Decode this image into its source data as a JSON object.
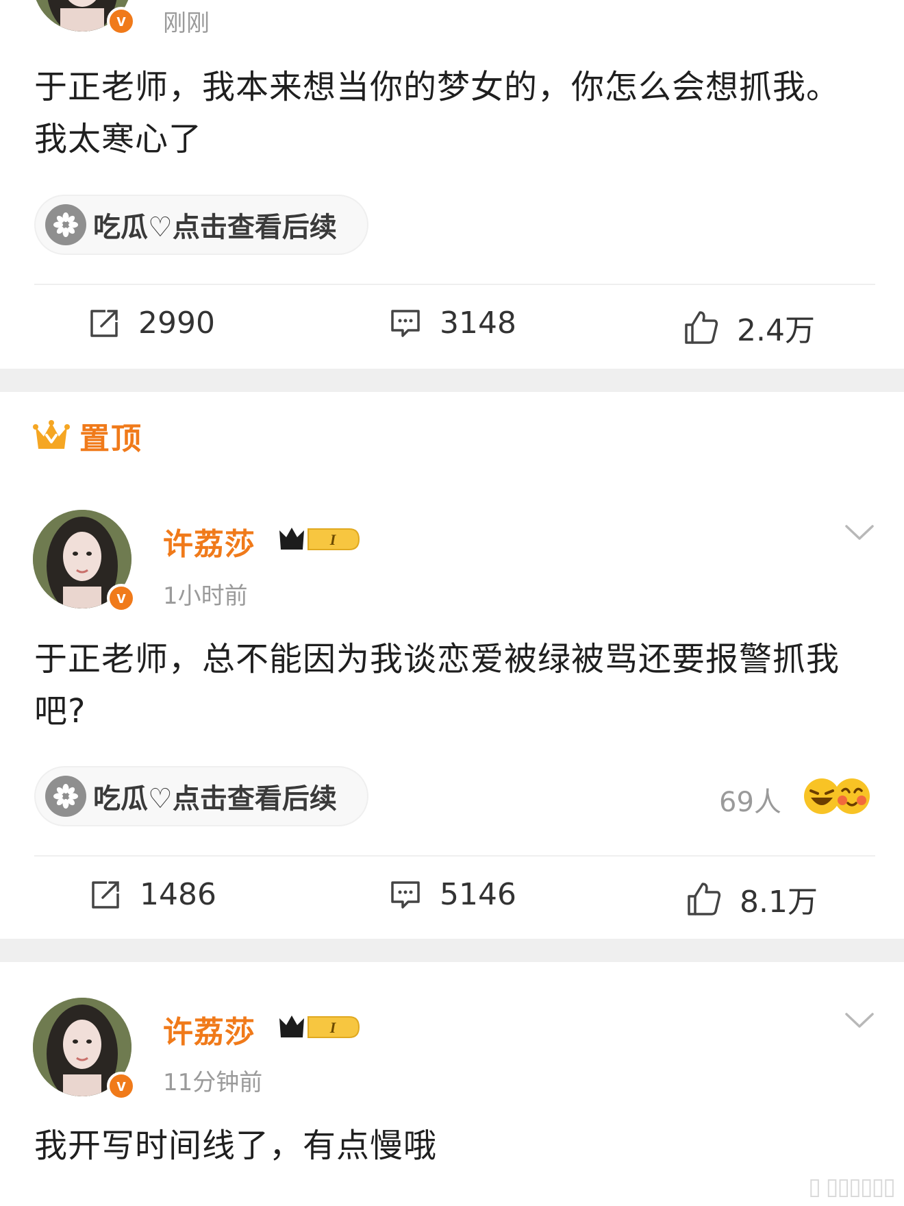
{
  "colors": {
    "accent": "#f07a1a",
    "separator": "#efefef",
    "muted": "#9a9a9a"
  },
  "posts": [
    {
      "time": "刚刚",
      "text": "于正老师，我本来想当你的梦女的，你怎么会想抓我。我太寒心了",
      "topic": "吃瓜♡点击查看后续",
      "actions": {
        "repost": "2990",
        "comment": "3148",
        "like": "2.4万"
      }
    },
    {
      "pinned_label": "置顶",
      "author": "许荔莎",
      "level": "I",
      "time": "1小时前",
      "text": "于正老师，总不能因为我谈恋爱被绿被骂还要报警抓我吧?",
      "topic": "吃瓜♡点击查看后续",
      "reaction_count": "69人",
      "actions": {
        "repost": "1486",
        "comment": "5146",
        "like": "8.1万"
      }
    },
    {
      "author": "许荔莎",
      "level": "I",
      "time": "11分钟前",
      "text": "我开写时间线了，有点慢哦"
    }
  ],
  "icons": {
    "verified": "v",
    "repost": "repost-icon",
    "comment": "comment-icon",
    "like": "like-icon",
    "topic": "melon-seed-icon",
    "pinned": "crown-icon",
    "more": "chevron-down-icon"
  }
}
